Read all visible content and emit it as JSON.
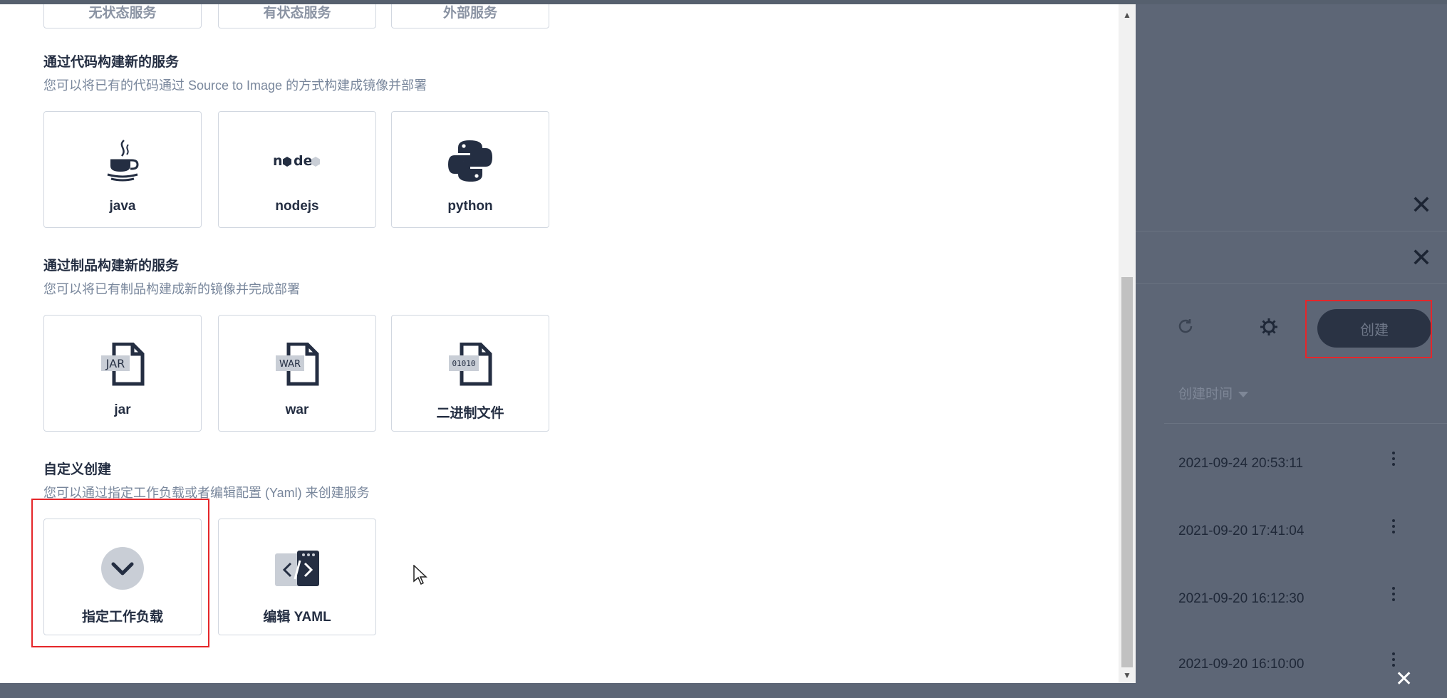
{
  "top_cards": [
    {
      "label": "无状态服务"
    },
    {
      "label": "有状态服务"
    },
    {
      "label": "外部服务"
    }
  ],
  "sections": [
    {
      "title": "通过代码构建新的服务",
      "description": "您可以将已有的代码通过 Source to Image 的方式构建成镜像并部署",
      "cards": [
        {
          "label": "java",
          "icon": "java-icon"
        },
        {
          "label": "nodejs",
          "icon": "nodejs-icon"
        },
        {
          "label": "python",
          "icon": "python-icon"
        }
      ]
    },
    {
      "title": "通过制品构建新的服务",
      "description": "您可以将已有制品构建成新的镜像并完成部署",
      "cards": [
        {
          "label": "jar",
          "icon": "jar-file-icon",
          "badge": "JAR"
        },
        {
          "label": "war",
          "icon": "war-file-icon",
          "badge": "WAR"
        },
        {
          "label": "二进制文件",
          "icon": "binary-file-icon",
          "badge": "01010"
        }
      ]
    },
    {
      "title": "自定义创建",
      "description": "您可以通过指定工作负载或者编辑配置 (Yaml) 来创建服务",
      "cards": [
        {
          "label": "指定工作负载",
          "icon": "workload-icon"
        },
        {
          "label": "编辑 YAML",
          "icon": "yaml-code-icon"
        }
      ]
    }
  ],
  "right_panel": {
    "create_label": "创建",
    "sort_label": "创建时间",
    "rows": [
      {
        "timestamp": "2021-09-24 20:53:11"
      },
      {
        "timestamp": "2021-09-20 17:41:04"
      },
      {
        "timestamp": "2021-09-20 16:12:30"
      },
      {
        "timestamp": "2021-09-20 16:10:00"
      }
    ]
  },
  "colors": {
    "highlight": "#e5262a",
    "overlay": "#5d6676",
    "text_primary": "#242e42",
    "text_secondary": "#79879c"
  }
}
